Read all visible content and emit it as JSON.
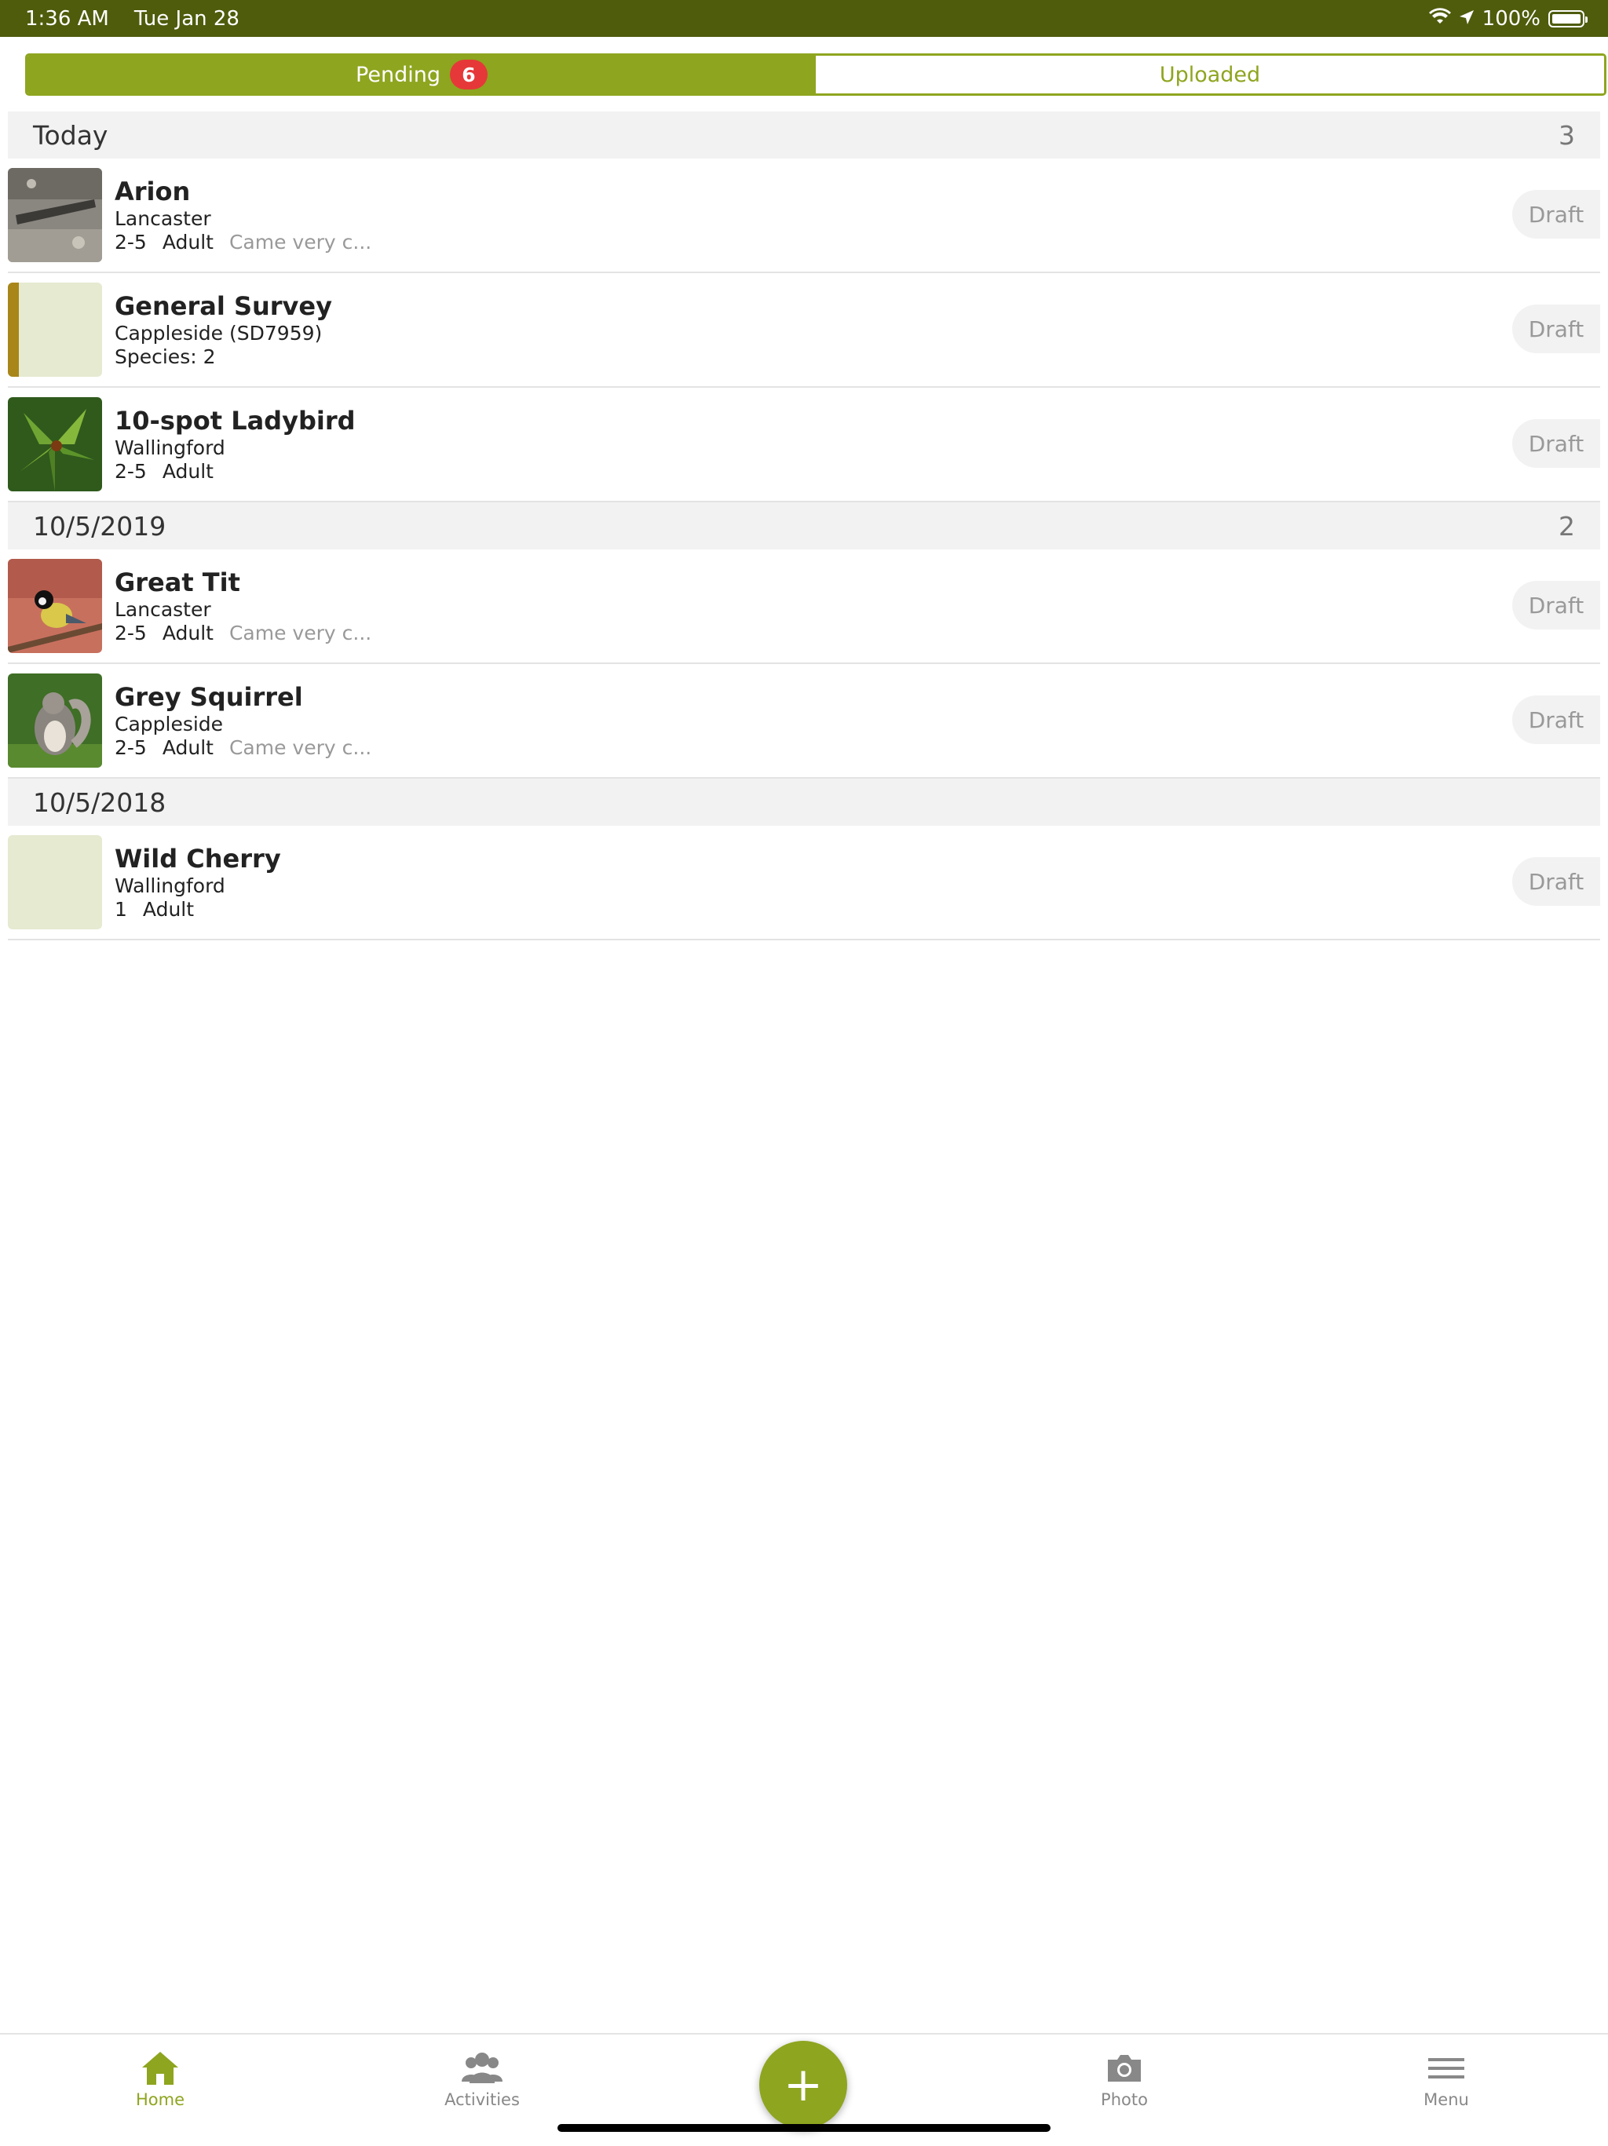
{
  "status_bar": {
    "time": "1:36 AM",
    "date": "Tue Jan 28",
    "battery": "100%"
  },
  "segment": {
    "pending_label": "Pending",
    "pending_count": "6",
    "uploaded_label": "Uploaded"
  },
  "sections": [
    {
      "title": "Today",
      "count": "3",
      "items": [
        {
          "title": "Arion",
          "location": "Lancaster",
          "number": "2-5",
          "stage": "Adult",
          "comment": "Came very c...",
          "status": "Draft"
        },
        {
          "title": "General Survey",
          "location": "Cappleside (SD7959)",
          "number": "Species: 2",
          "stage": "",
          "comment": "",
          "status": "Draft"
        },
        {
          "title": "10-spot Ladybird",
          "location": "Wallingford",
          "number": "2-5",
          "stage": "Adult",
          "comment": "",
          "status": "Draft"
        }
      ]
    },
    {
      "title": "10/5/2019",
      "count": "2",
      "items": [
        {
          "title": "Great Tit",
          "location": "Lancaster",
          "number": "2-5",
          "stage": "Adult",
          "comment": "Came very c...",
          "status": "Draft"
        },
        {
          "title": "Grey Squirrel",
          "location": "Cappleside",
          "number": "2-5",
          "stage": "Adult",
          "comment": "Came very c...",
          "status": "Draft"
        }
      ]
    },
    {
      "title": "10/5/2018",
      "count": "",
      "items": [
        {
          "title": "Wild Cherry",
          "location": "Wallingford",
          "number": "1",
          "stage": "Adult",
          "comment": "",
          "status": "Draft"
        }
      ]
    }
  ],
  "tabbar": {
    "home": "Home",
    "activities": "Activities",
    "photo": "Photo",
    "menu": "Menu",
    "fab": "+"
  },
  "colors": {
    "accent": "#8ea51f",
    "status_bar": "#4e5c0c",
    "badge": "#e63838"
  }
}
